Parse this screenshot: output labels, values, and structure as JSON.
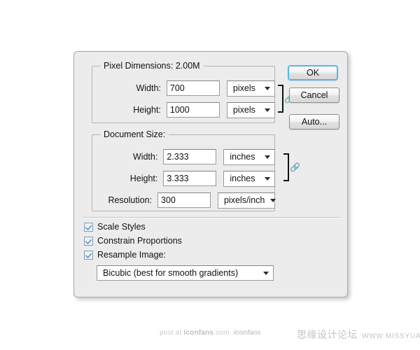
{
  "dialog": {
    "pixel_dimensions": {
      "legend": "Pixel Dimensions:  2.00M",
      "width_label": "Width:",
      "width_value": "700",
      "width_unit": "pixels",
      "height_label": "Height:",
      "height_value": "1000",
      "height_unit": "pixels",
      "link_icon": "chain-link-icon"
    },
    "document_size": {
      "legend": "Document Size:",
      "width_label": "Width:",
      "width_value": "2.333",
      "width_unit": "inches",
      "height_label": "Height:",
      "height_value": "3.333",
      "height_unit": "inches",
      "resolution_label": "Resolution:",
      "resolution_value": "300",
      "resolution_unit": "pixels/inch",
      "link_icon": "chain-link-icon"
    },
    "options": {
      "scale_styles": "Scale Styles",
      "constrain_proportions": "Constrain Proportions",
      "resample_image": "Resample Image:",
      "resample_method": "Bicubic (best for smooth gradients)"
    },
    "buttons": {
      "ok": "OK",
      "cancel": "Cancel",
      "auto": "Auto..."
    },
    "colors": {
      "dialog_background": "#ececec",
      "focus_ring": "#53b8e8",
      "checkbox_border": "#7f9db9",
      "checkbox_fill": "#eaf1f8",
      "check_mark": "#2b5d93",
      "groupbox_border": "#b4b4b4"
    }
  },
  "watermarks": {
    "left": {
      "prefix": "post at ",
      "brand": "iconfans",
      "suffix": ".com",
      "logo": "iconfans"
    },
    "right": {
      "forum": "思缘设计论坛",
      "url": "WWW.MISSYUAN.COM"
    }
  }
}
